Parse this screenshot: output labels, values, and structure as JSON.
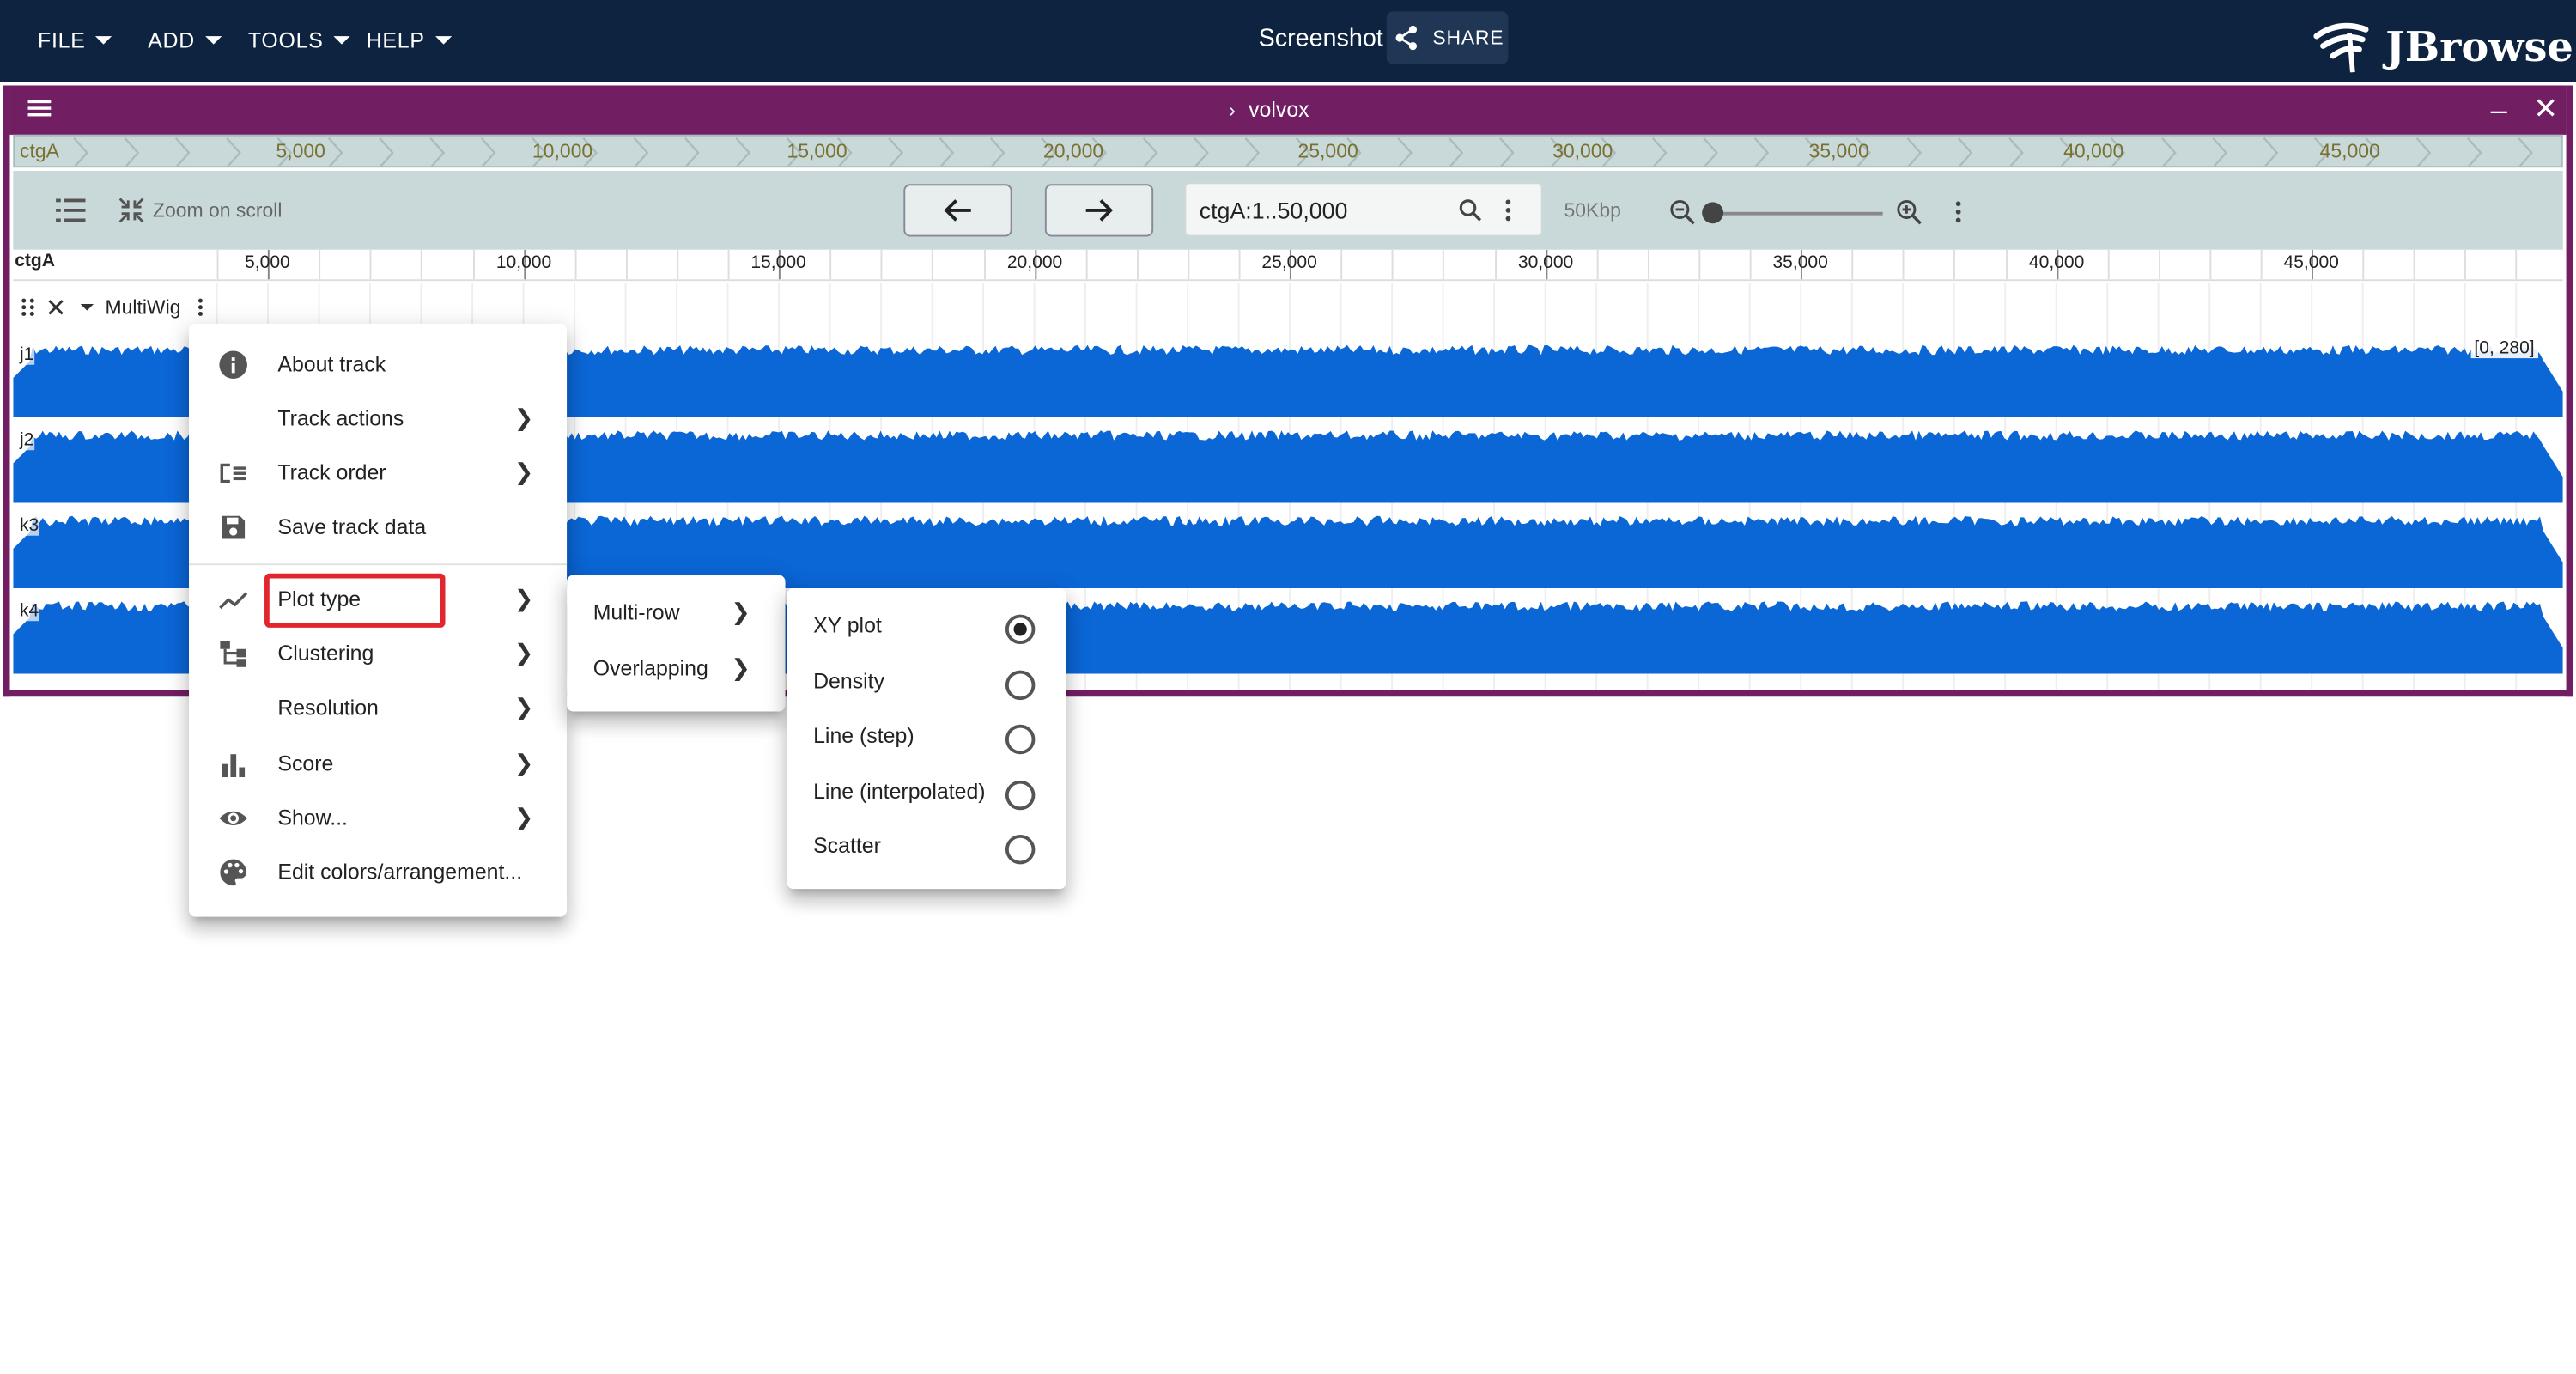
{
  "appbar": {
    "menus": [
      "FILE",
      "ADD",
      "TOOLS",
      "HELP"
    ],
    "session_title": "Screenshot",
    "share_label": "SHARE",
    "logo_text": "JBrowse"
  },
  "view": {
    "title": "volvox",
    "overview": {
      "ref_name": "ctgA",
      "labels": [
        "5,000",
        "10,000",
        "15,000",
        "20,000",
        "25,000",
        "30,000",
        "35,000",
        "40,000",
        "45,000"
      ]
    },
    "toolbar": {
      "zoom_on_scroll": "Zoom on scroll",
      "location": "ctgA:1..50,000",
      "bp_per_px": "50Kbp"
    },
    "ruler": {
      "ref_name": "ctgA",
      "labels": [
        "5,000",
        "10,000",
        "15,000",
        "20,000",
        "25,000",
        "30,000",
        "35,000",
        "40,000",
        "45,000"
      ]
    },
    "track": {
      "name": "MultiWig",
      "rows": [
        "j1",
        "j2",
        "k3",
        "k4"
      ],
      "scale": "[0, 280]",
      "fill_color": "#0b66d6"
    }
  },
  "track_menu": {
    "items": [
      {
        "label": "About track",
        "icon": "info-icon"
      },
      {
        "label": "Track actions",
        "icon": ""
      },
      {
        "label": "Track order",
        "icon": "track-order-icon"
      },
      {
        "label": "Save track data",
        "icon": "save-icon"
      },
      {
        "label": "Plot type",
        "icon": "line-chart-icon"
      },
      {
        "label": "Clustering",
        "icon": "clustering-icon"
      },
      {
        "label": "Resolution",
        "icon": ""
      },
      {
        "label": "Score",
        "icon": "bar-chart-icon"
      },
      {
        "label": "Show...",
        "icon": "eye-icon"
      },
      {
        "label": "Edit colors/arrangement...",
        "icon": "palette-icon"
      }
    ]
  },
  "plot_type_menu": {
    "items": [
      "Multi-row",
      "Overlapping"
    ]
  },
  "multirow_menu": {
    "items": [
      {
        "label": "XY plot",
        "selected": true
      },
      {
        "label": "Density",
        "selected": false
      },
      {
        "label": "Line (step)",
        "selected": false
      },
      {
        "label": "Line (interpolated)",
        "selected": false
      },
      {
        "label": "Scatter",
        "selected": false
      }
    ]
  }
}
